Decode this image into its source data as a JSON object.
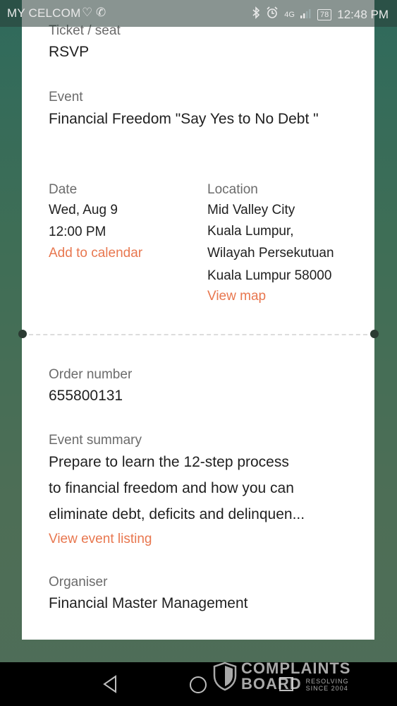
{
  "status_bar": {
    "carrier": "MY CELCOM",
    "carrier_icons": "♡ ✆",
    "bluetooth_icon": "bluetooth-icon",
    "alarm_icon": "alarm-icon",
    "network": "4G",
    "battery": "78",
    "time": "12:48 PM"
  },
  "ticket": {
    "ticket_label": "Ticket / seat",
    "ticket_value": "RSVP",
    "event_label": "Event",
    "event_value": " Financial Freedom \"Say Yes to No Debt \"",
    "date_label": "Date",
    "date_day": "Wed, Aug 9",
    "date_time": "12:00 PM",
    "add_calendar": "Add to calendar",
    "location_label": "Location",
    "location_lines": [
      "Mid Valley City",
      "Kuala Lumpur,",
      "Wilayah Persekutuan",
      "Kuala Lumpur 58000"
    ],
    "view_map": "View map"
  },
  "order": {
    "order_label": "Order number",
    "order_value": "655800131",
    "summary_label": "Event summary",
    "summary_lines": [
      "Prepare to learn the 12-step process",
      "to financial freedom and how you can",
      "eliminate debt, deficits and delinquen..."
    ],
    "view_listing": "View event listing",
    "organiser_label": "Organiser",
    "organiser_value": "Financial Master Management"
  },
  "watermark": {
    "line1": "COMPLAINTS",
    "line2": "BOARD",
    "sub1": "RESOLVING",
    "sub2": "SINCE 2004"
  },
  "colors": {
    "accent": "#e8774f",
    "label": "#6b6b6b",
    "text": "#1f1f1f"
  }
}
